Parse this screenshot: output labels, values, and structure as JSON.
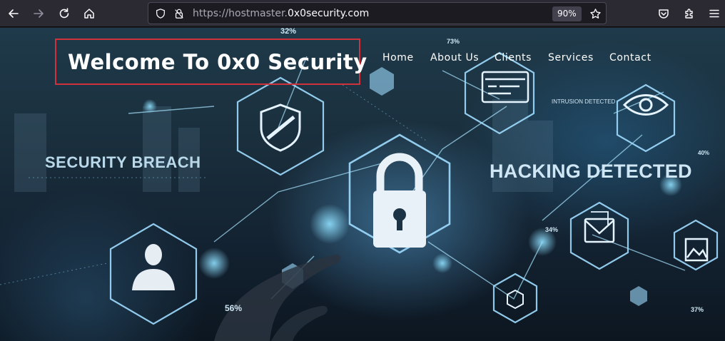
{
  "browser": {
    "url_prefix": "https://hostmaster.",
    "url_host": "0x0security.com",
    "zoom": "90%"
  },
  "page": {
    "brand_title": "Welcome To 0x0 Security",
    "nav": [
      {
        "label": "Home"
      },
      {
        "label": "About Us"
      },
      {
        "label": "Clients"
      },
      {
        "label": "Services"
      },
      {
        "label": "Contact"
      }
    ],
    "image_text": {
      "security_breach": "SECURITY BREACH",
      "hacking_detected": "HACKING DETECTED",
      "intrusion_detected": "INTRUSION DETECTED",
      "pct_32": "32%",
      "pct_73": "73%",
      "pct_56": "56%",
      "pct_34": "34%",
      "pct_40": "40%",
      "pct_37": "37%"
    }
  },
  "colors": {
    "accent_border": "#d0323b",
    "chrome_bg": "#2b2a33",
    "icon_glow": "#5fc3f0"
  }
}
